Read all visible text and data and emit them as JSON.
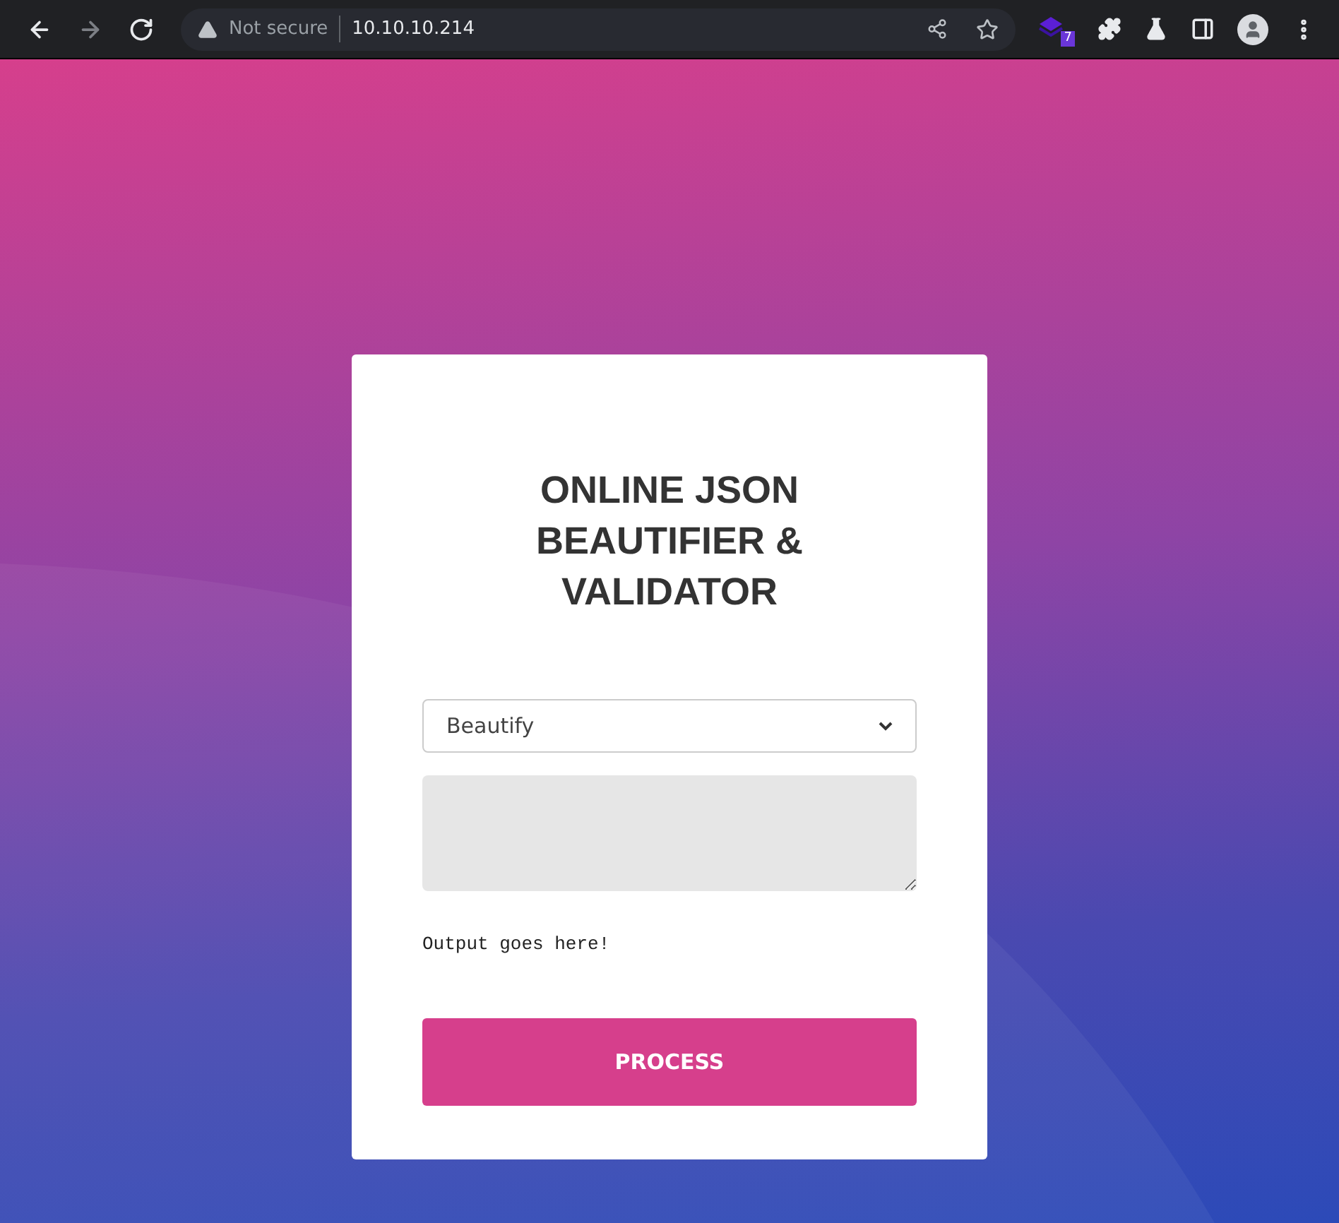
{
  "browser": {
    "nav": [
      {
        "kind": "back",
        "disabled": false
      },
      {
        "kind": "forward",
        "disabled": true
      },
      {
        "kind": "reload",
        "disabled": false
      }
    ],
    "security": "Not secure",
    "url": "10.10.10.214",
    "extension_badge": "7"
  },
  "card": {
    "title": "ONLINE JSON BEAUTIFIER & VALIDATOR",
    "mode": "Beautify",
    "output": "Output goes here!",
    "button": "PROCESS"
  }
}
